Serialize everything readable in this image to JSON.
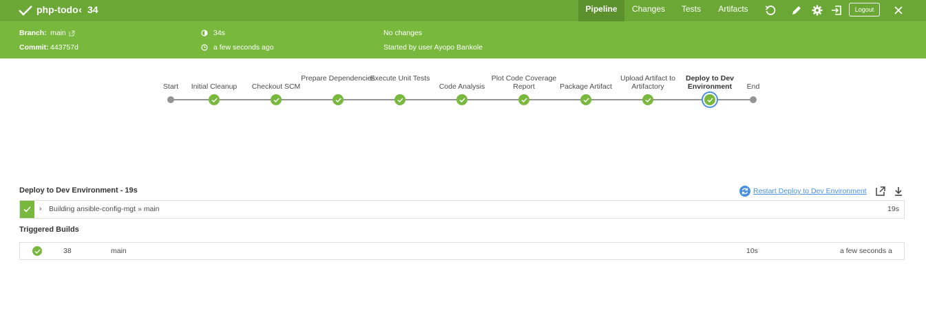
{
  "header": {
    "pipeline_name": "php-todo",
    "run_number": "34",
    "tabs": [
      {
        "label": "Pipeline",
        "active": true
      },
      {
        "label": "Changes",
        "active": false
      },
      {
        "label": "Tests",
        "active": false
      },
      {
        "label": "Artifacts",
        "active": false
      }
    ],
    "icons": [
      "replay-icon",
      "edit-icon",
      "gear-icon",
      "exit-icon"
    ],
    "logout_label": "Logout",
    "close_icon": "close-icon"
  },
  "info": {
    "branch_label": "Branch:",
    "branch_value": "main",
    "commit_label": "Commit:",
    "commit_value": "443757d",
    "duration": "34s",
    "time_ago": "a few seconds ago",
    "changes": "No changes",
    "started_by": "Started by user Ayopo Bankole"
  },
  "pipeline": {
    "stages": [
      {
        "label": "Start",
        "kind": "terminal"
      },
      {
        "label": "Initial Cleanup",
        "kind": "success"
      },
      {
        "label": "Checkout SCM",
        "kind": "success"
      },
      {
        "label": "Prepare Dependencies",
        "kind": "success"
      },
      {
        "label": "Execute Unit Tests",
        "kind": "success"
      },
      {
        "label": "Code Analysis",
        "kind": "success"
      },
      {
        "label": "Plot Code Coverage Report",
        "kind": "success"
      },
      {
        "label": "Package Artifact",
        "kind": "success"
      },
      {
        "label": "Upload Artifact to Artifactory",
        "kind": "success"
      },
      {
        "label": "Deploy to Dev Environment",
        "kind": "success",
        "selected": true
      },
      {
        "label": "End",
        "kind": "terminal"
      }
    ]
  },
  "stage_detail": {
    "title": "Deploy to Dev Environment - 19s",
    "restart_label": "Restart Deploy to Dev Environment",
    "step_text": "Building ansible-config-mgt » main",
    "step_duration": "19s"
  },
  "triggered": {
    "title": "Triggered Builds",
    "rows": [
      {
        "number": "38",
        "branch": "main",
        "duration": "10s",
        "time": "a few seconds ago"
      }
    ]
  },
  "colors": {
    "header_green": "#6aa734",
    "info_green": "#78b83d",
    "success_green": "#78b83d",
    "link_blue": "#4a90e2"
  }
}
